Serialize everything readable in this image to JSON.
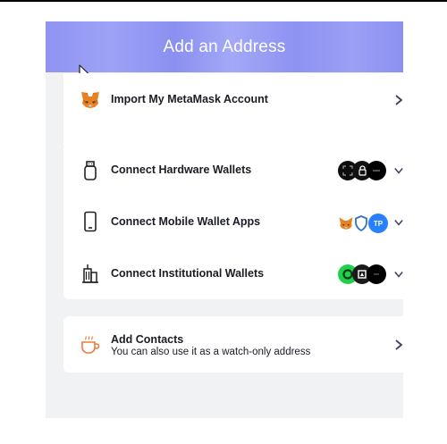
{
  "header": {
    "title": "Add an Address"
  },
  "import_card": {
    "label": "Import My MetaMask Account",
    "icon": "metamask-fox-icon"
  },
  "connect_card": {
    "items": [
      {
        "label": "Connect Hardware Wallets",
        "icon": "usb-device-icon",
        "badges": [
          "ledger-icon",
          "lock-icon",
          "wallet-logo-icon"
        ]
      },
      {
        "label": "Connect Mobile Wallet Apps",
        "icon": "mobile-phone-icon",
        "badges": [
          "metamask-fox-icon",
          "shield-icon",
          "tokenpocket-icon"
        ],
        "tp_text": "TP"
      },
      {
        "label": "Connect Institutional Wallets",
        "icon": "institution-building-icon",
        "badges": [
          "green-ring-icon",
          "fireblocks-icon",
          "custody-logo-icon"
        ]
      }
    ]
  },
  "contacts_card": {
    "label": "Add Contacts",
    "sublabel": "You can also use it as a watch-only address",
    "icon": "coffee-cup-icon"
  },
  "colors": {
    "header_bg": "#9397f3",
    "panel_bg": "#f1f2f4",
    "text": "#1a1c26",
    "chevron": "#3a3f63",
    "accent_orange": "#f07a3e"
  }
}
